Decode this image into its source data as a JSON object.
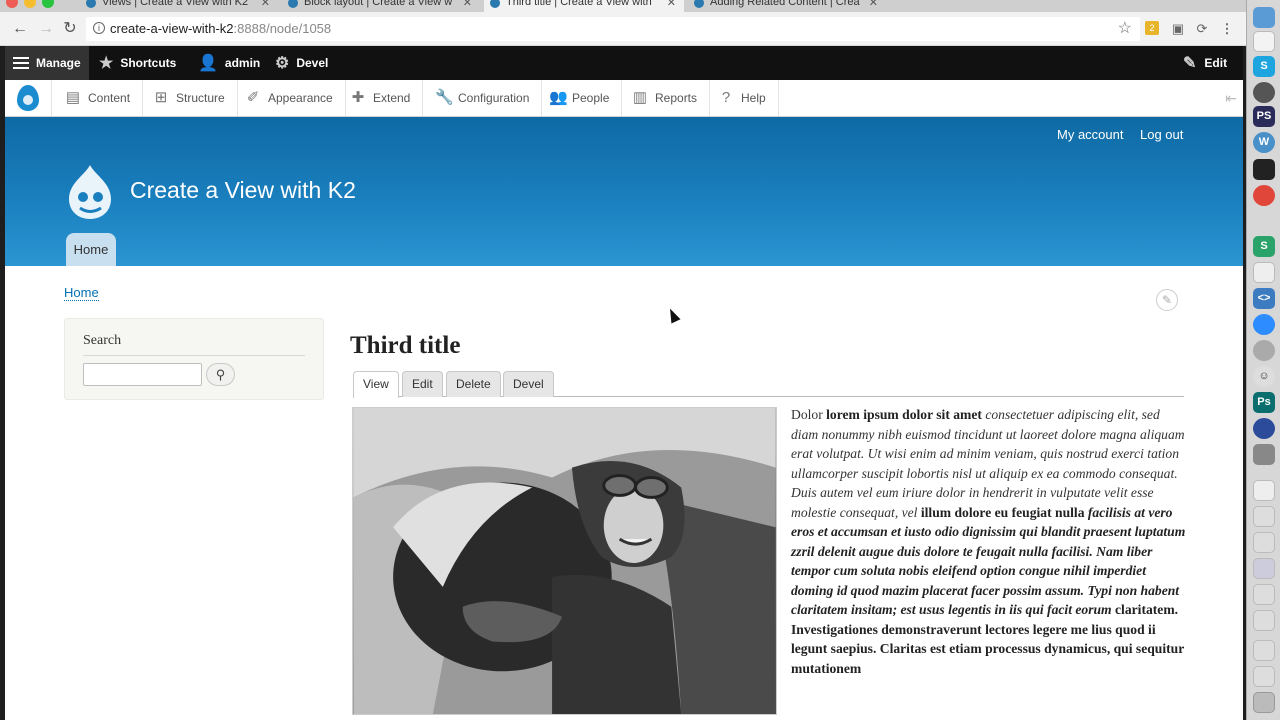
{
  "browser": {
    "tabs": [
      {
        "title": "Views | Create a View with K2",
        "active": false
      },
      {
        "title": "Block layout | Create a View w",
        "active": false
      },
      {
        "title": "Third title | Create a View with",
        "active": true
      },
      {
        "title": "Adding Related Content | Crea",
        "active": false
      }
    ],
    "url_host": "create-a-view-with-k2",
    "url_rest": ":8888/node/1058"
  },
  "admin_bar": {
    "manage": "Manage",
    "shortcuts": "Shortcuts",
    "user": "admin",
    "devel": "Devel",
    "edit": "Edit"
  },
  "admin_tray": {
    "items": [
      "Content",
      "Structure",
      "Appearance",
      "Extend",
      "Configuration",
      "People",
      "Reports",
      "Help"
    ]
  },
  "site": {
    "secondary_menu": [
      "My account",
      "Log out"
    ],
    "name": "Create a View with K2",
    "main_menu": [
      "Home"
    ],
    "breadcrumb": "Home"
  },
  "sidebar": {
    "search_title": "Search",
    "search_value": ""
  },
  "node": {
    "title": "Third title",
    "tabs": [
      "View",
      "Edit",
      "Delete",
      "Devel"
    ],
    "active_tab": "View",
    "body_segments": [
      {
        "style": "normal",
        "text": "Dolor "
      },
      {
        "style": "bold",
        "text": "lorem ipsum dolor sit amet"
      },
      {
        "style": "italic",
        "text": " consectetuer adipiscing elit, sed diam nonummy nibh euismod tincidunt ut laoreet dolore magna aliquam erat volutpat. Ut wisi enim ad minim veniam, quis nostrud exerci tation ullamcorper suscipit lobortis nisl ut aliquip ex ea commodo consequat. Duis autem vel eum iriure dolor in hendrerit in vulputate velit esse molestie consequat, vel "
      },
      {
        "style": "bold",
        "text": "illum dolore eu feugiat nulla "
      },
      {
        "style": "bold-italic",
        "text": "facilisis at vero eros et accumsan et iusto odio dignissim qui blandit praesent luptatum zzril delenit augue duis dolore te feugait nulla facilisi. Nam liber tempor cum soluta nobis eleifend option congue nihil imperdiet doming id quod mazim placerat facer possim assum. Typi non habent claritatem insitam; est usus legentis in iis qui facit eorum"
      },
      {
        "style": "bold",
        "text": " claritatem. Investigationes demonstraverunt lectores legere me lius quod ii legunt saepius. Claritas est etiam processus dynamicus, qui sequitur mutationem"
      }
    ]
  },
  "colors": {
    "header_blue": "#1a7fbe",
    "link_blue": "#0071b3",
    "admin_bar": "#111111"
  }
}
